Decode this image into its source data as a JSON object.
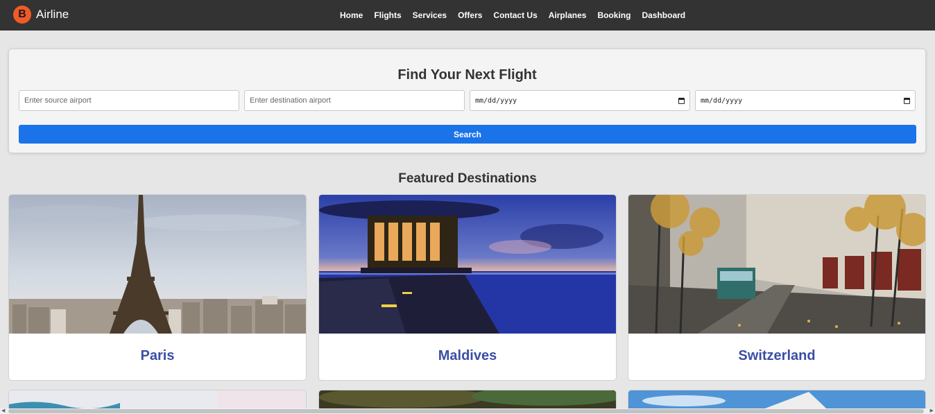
{
  "brand": {
    "logo_letter": "B",
    "name": "Airline",
    "logo_color": "#f05a28"
  },
  "nav": {
    "links": [
      "Home",
      "Flights",
      "Services",
      "Offers",
      "Contact Us",
      "Airplanes",
      "Booking",
      "Dashboard"
    ]
  },
  "search": {
    "title": "Find Your Next Flight",
    "source_placeholder": "Enter source airport",
    "destination_placeholder": "Enter destination airport",
    "depart_date": "mm/dd/yyyy",
    "return_date": "mm/dd/yyyy",
    "button_label": "Search",
    "button_color": "#1a73e8"
  },
  "featured": {
    "title": "Featured Destinations",
    "destinations": [
      {
        "name": "Paris",
        "image": "eiffel-tower-photo"
      },
      {
        "name": "Maldives",
        "image": "overwater-pavilion-photo"
      },
      {
        "name": "Switzerland",
        "image": "zurich-street-tram-photo"
      }
    ],
    "name_color": "#3a4ea6"
  }
}
